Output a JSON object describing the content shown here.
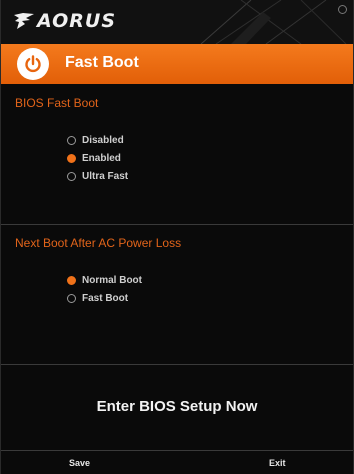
{
  "brand": {
    "logo_text": "AORUS"
  },
  "header": {
    "title": "Fast Boot",
    "icon": "power-icon"
  },
  "bios_fast_boot": {
    "title": "BIOS Fast Boot",
    "options": [
      {
        "label": "Disabled",
        "selected": false
      },
      {
        "label": "Enabled",
        "selected": true
      },
      {
        "label": "Ultra Fast",
        "selected": false
      }
    ]
  },
  "next_boot": {
    "title": "Next Boot After AC Power Loss",
    "options": [
      {
        "label": "Normal Boot",
        "selected": true
      },
      {
        "label": "Fast Boot",
        "selected": false
      }
    ]
  },
  "actions": {
    "enter_bios": "Enter BIOS Setup Now",
    "save": "Save",
    "exit": "Exit"
  },
  "colors": {
    "accent": "#f0721a",
    "section_title": "#e2641a",
    "background": "#0a0a0a"
  }
}
